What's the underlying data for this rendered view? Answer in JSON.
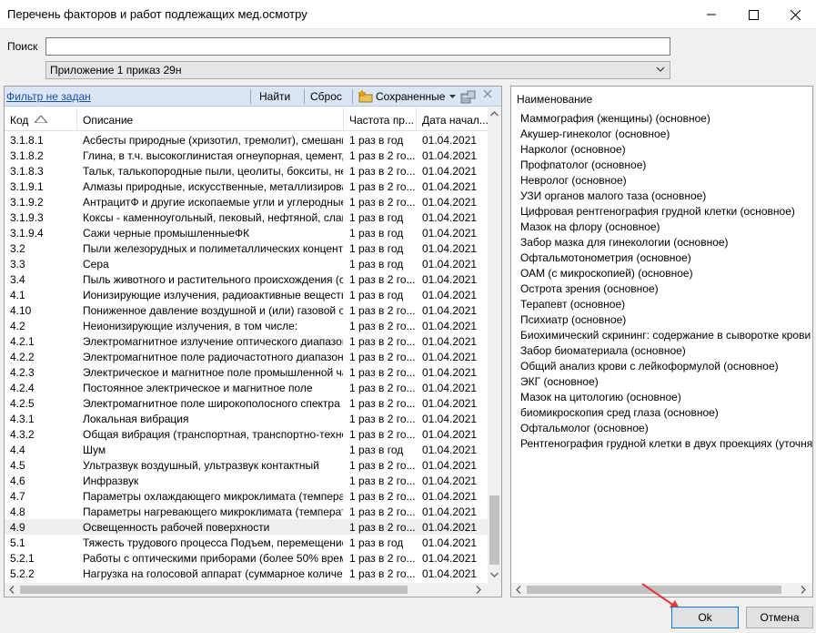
{
  "window": {
    "title": "Перечень факторов и работ подлежащих мед.осмотру"
  },
  "search": {
    "label": "Поиск",
    "value": "",
    "placeholder": ""
  },
  "combo": {
    "selected": "Приложение 1 приказ 29н"
  },
  "filterbar": {
    "filter_link": "Фильтр не задан",
    "find": "Найти",
    "reset": "Сброс",
    "saved": "Сохраненные"
  },
  "grid": {
    "columns": [
      "Код",
      "Описание",
      "Частота пр...",
      "Дата начал..."
    ],
    "rows": [
      {
        "code": "3.1.8.1",
        "desc": "Асбесты природные (хризотил, тремолит), смешанн...",
        "freq": "1 раз в год",
        "date": "01.04.2021"
      },
      {
        "code": "3.1.8.2",
        "desc": "Глина, в т.ч. высокоглинистая огнеупорная, цемент, ...",
        "freq": "1 раз в 2 го...",
        "date": "01.04.2021"
      },
      {
        "code": "3.1.8.3",
        "desc": "Тальк, талькопородные пыли, цеолиты, бокситы, не...",
        "freq": "1 раз в 2 го...",
        "date": "01.04.2021"
      },
      {
        "code": "3.1.9.1",
        "desc": "Алмазы природные, искусственные, металлизирова...",
        "freq": "1 раз в 2 го...",
        "date": "01.04.2021"
      },
      {
        "code": "3.1.9.2",
        "desc": "АнтрацитФ и другие ископаемые угли и углеродные ...",
        "freq": "1 раз в 2 го...",
        "date": "01.04.2021"
      },
      {
        "code": "3.1.9.3",
        "desc": "Коксы - каменноугольный, пековый, нефтяной, слан...",
        "freq": "1 раз в год",
        "date": "01.04.2021"
      },
      {
        "code": "3.1.9.4",
        "desc": "Сажи черные промышленныеФК",
        "freq": "1 раз в год",
        "date": "01.04.2021"
      },
      {
        "code": "3.2",
        "desc": "Пыли железорудных и полиметаллических концентр...",
        "freq": "1 раз в год",
        "date": "01.04.2021"
      },
      {
        "code": "3.3",
        "desc": "Сера",
        "freq": "1 раз в год",
        "date": "01.04.2021"
      },
      {
        "code": "3.4",
        "desc": "Пыль животного и растительного происхождения (с ...",
        "freq": "1 раз в 2 го...",
        "date": "01.04.2021"
      },
      {
        "code": "4.1",
        "desc": "Ионизирующие излучения, радиоактивные вещества",
        "freq": "1 раз в год",
        "date": "01.04.2021"
      },
      {
        "code": "4.10",
        "desc": "Пониженное давление воздушной и (или) газовой ср...",
        "freq": "1 раз в 2 го...",
        "date": "01.04.2021"
      },
      {
        "code": "4.2",
        "desc": "Неионизирующие излучения, в том числе:",
        "freq": "1 раз в 2 го...",
        "date": "01.04.2021"
      },
      {
        "code": "4.2.1",
        "desc": "Электромагнитное излучение оптического диапазон...",
        "freq": "1 раз в 2 го...",
        "date": "01.04.2021"
      },
      {
        "code": "4.2.2",
        "desc": "Электромагнитное поле радиочастотного диапазона...",
        "freq": "1 раз в 2 го...",
        "date": "01.04.2021"
      },
      {
        "code": "4.2.3",
        "desc": "Электрическое и магнитное поле промышленной час...",
        "freq": "1 раз в 2 го...",
        "date": "01.04.2021"
      },
      {
        "code": "4.2.4",
        "desc": "Постоянное электрическое и магнитное поле",
        "freq": "1 раз в 2 го...",
        "date": "01.04.2021"
      },
      {
        "code": "4.2.5",
        "desc": "Электромагнитное поле широкополосного спектра ч...",
        "freq": "1 раз в 2 го...",
        "date": "01.04.2021"
      },
      {
        "code": "4.3.1",
        "desc": "Локальная вибрация",
        "freq": "1 раз в 2 го...",
        "date": "01.04.2021"
      },
      {
        "code": "4.3.2",
        "desc": "Общая вибрация (транспортная, транспортно-технол...",
        "freq": "1 раз в 2 го...",
        "date": "01.04.2021"
      },
      {
        "code": "4.4",
        "desc": "Шум",
        "freq": "1 раз в год",
        "date": "01.04.2021"
      },
      {
        "code": "4.5",
        "desc": "Ультразвук воздушный, ультразвук контактный",
        "freq": "1 раз в 2 го...",
        "date": "01.04.2021"
      },
      {
        "code": "4.6",
        "desc": "Инфразвук",
        "freq": "1 раз в 2 го...",
        "date": "01.04.2021"
      },
      {
        "code": "4.7",
        "desc": "Параметры охлаждающего микроклимата (температ...",
        "freq": "1 раз в 2 го...",
        "date": "01.04.2021"
      },
      {
        "code": "4.8",
        "desc": "Параметры нагревающего микроклимата (температ...",
        "freq": "1 раз в 2 го...",
        "date": "01.04.2021"
      },
      {
        "code": "4.9",
        "desc": "Освещенность рабочей поверхности",
        "freq": "1 раз в 2 го...",
        "date": "01.04.2021",
        "selected": true
      },
      {
        "code": "5.1",
        "desc": "Тяжесть трудового процесса Подъем, перемещение...",
        "freq": "1 раз в год",
        "date": "01.04.2021"
      },
      {
        "code": "5.2.1",
        "desc": "Работы с оптическими приборами (более 50% време...",
        "freq": "1 раз в 2 го...",
        "date": "01.04.2021"
      },
      {
        "code": "5.2.2",
        "desc": "Нагрузка на голосовой аппарат (суммарное количес...",
        "freq": "1 раз в 2 го...",
        "date": "01.04.2021"
      }
    ]
  },
  "right_panel": {
    "header": "Наименование",
    "items": [
      "Маммография (женщины) (основное)",
      "Акушер-гинеколог (основное)",
      "Нарколог (основное)",
      "Профпатолог (основное)",
      "Невролог (основное)",
      "УЗИ органов малого таза (основное)",
      "Цифровая рентгенография грудной клетки (основное)",
      "Мазок на флору (основное)",
      "Забор мазка для гинекологии (основное)",
      "Офтальмотонометрия (основное)",
      "ОАМ (с микроскопией) (основное)",
      "Острота зрения (основное)",
      "Терапевт (основное)",
      "Психиатр (основное)",
      "Биохимический скрининг: содержание в сыворотке крови глю...",
      "Забор биоматериала (основное)",
      "Общий анализ крови с лейкоформулой (основное)",
      "ЭКГ (основное)",
      "Мазок на цитологию (основное)",
      "биомикроскопия сред глаза (основное)",
      "Офтальмолог (основное)",
      "Рентгенография грудной клетки в двух проекциях (уточняющее"
    ]
  },
  "buttons": {
    "ok": "Ok",
    "cancel": "Отмена"
  },
  "colors": {
    "filterbar_bg": "#dbe6f5",
    "link": "#1a4fa0",
    "ok_border": "#0078d7",
    "annotation_arrow": "#e53935"
  },
  "icons": [
    "minimize-icon",
    "maximize-icon",
    "close-icon",
    "chevron-down-icon",
    "sort-asc-icon",
    "folder-saved-icon",
    "toolbar-settings-icon",
    "filter-close-icon",
    "annotation-arrow"
  ]
}
